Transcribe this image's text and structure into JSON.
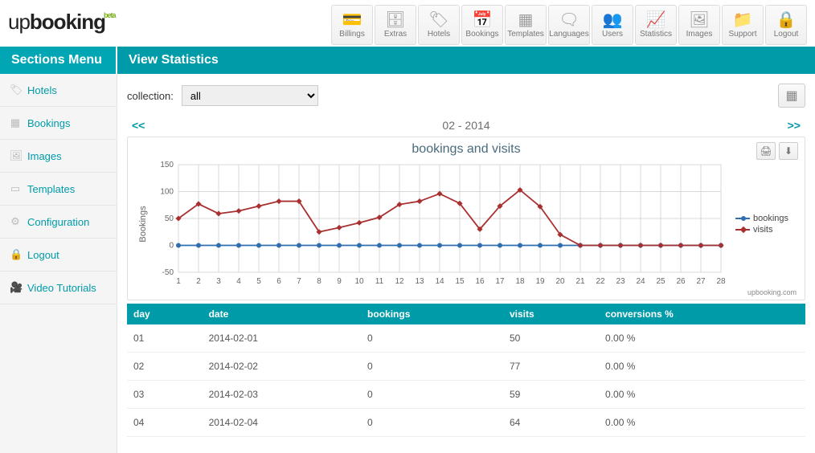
{
  "logo": {
    "prefix": "up",
    "main": "booking",
    "badge": "beta"
  },
  "topnav": [
    {
      "label": "Billings",
      "icon": "💳",
      "name": "billings"
    },
    {
      "label": "Extras",
      "icon": "🗄",
      "name": "extras"
    },
    {
      "label": "Hotels",
      "icon": "🏷",
      "name": "hotels"
    },
    {
      "label": "Bookings",
      "icon": "📅",
      "name": "bookings"
    },
    {
      "label": "Templates",
      "icon": "▦",
      "name": "templates"
    },
    {
      "label": "Languages",
      "icon": "🗨",
      "name": "languages"
    },
    {
      "label": "Users",
      "icon": "👥",
      "name": "users"
    },
    {
      "label": "Statistics",
      "icon": "📈",
      "name": "statistics"
    },
    {
      "label": "Images",
      "icon": "🖼",
      "name": "images"
    },
    {
      "label": "Support",
      "icon": "📁",
      "name": "support"
    },
    {
      "label": "Logout",
      "icon": "🔒",
      "name": "logout"
    }
  ],
  "tealbar": {
    "left": "Sections Menu",
    "right": "View Statistics"
  },
  "sidebar": [
    {
      "label": "Hotels",
      "icon": "🏷",
      "name": "hotels"
    },
    {
      "label": "Bookings",
      "icon": "▦",
      "name": "bookings"
    },
    {
      "label": "Images",
      "icon": "🖼",
      "name": "images"
    },
    {
      "label": "Templates",
      "icon": "▭",
      "name": "templates"
    },
    {
      "label": "Configuration",
      "icon": "⚙",
      "name": "configuration"
    },
    {
      "label": "Logout",
      "icon": "🔒",
      "name": "logout"
    },
    {
      "label": "Video Tutorials",
      "icon": "🎥",
      "name": "video-tutorials"
    }
  ],
  "toolbar": {
    "collection_label": "collection:",
    "collection_value": "all"
  },
  "monthnav": {
    "prev": "<<",
    "label": "02 - 2014",
    "next": ">>"
  },
  "chart": {
    "title": "bookings and visits",
    "ylabel": "Bookings",
    "credit": "upbooking.com",
    "legend": {
      "bookings": "bookings",
      "visits": "visits"
    }
  },
  "chart_data": {
    "type": "line",
    "title": "bookings and visits",
    "xlabel": "",
    "ylabel": "Bookings",
    "ylim": [
      -50,
      150
    ],
    "x": [
      1,
      2,
      3,
      4,
      5,
      6,
      7,
      8,
      9,
      10,
      11,
      12,
      13,
      14,
      15,
      16,
      17,
      18,
      19,
      20,
      21,
      22,
      23,
      24,
      25,
      26,
      27,
      28
    ],
    "series": [
      {
        "name": "bookings",
        "color": "#2f6fae",
        "values": [
          0,
          0,
          0,
          0,
          0,
          0,
          0,
          0,
          0,
          0,
          0,
          0,
          0,
          0,
          0,
          0,
          0,
          0,
          0,
          0,
          0,
          0,
          0,
          0,
          0,
          0,
          0,
          0
        ]
      },
      {
        "name": "visits",
        "color": "#a93030",
        "values": [
          50,
          77,
          59,
          64,
          73,
          82,
          82,
          25,
          33,
          42,
          52,
          76,
          82,
          96,
          78,
          30,
          73,
          103,
          72,
          20,
          0,
          0,
          0,
          0,
          0,
          0,
          0,
          0
        ]
      }
    ]
  },
  "table": {
    "headers": [
      "day",
      "date",
      "bookings",
      "visits",
      "conversions %"
    ],
    "rows": [
      [
        "01",
        "2014-02-01",
        "0",
        "50",
        "0.00 %"
      ],
      [
        "02",
        "2014-02-02",
        "0",
        "77",
        "0.00 %"
      ],
      [
        "03",
        "2014-02-03",
        "0",
        "59",
        "0.00 %"
      ],
      [
        "04",
        "2014-02-04",
        "0",
        "64",
        "0.00 %"
      ]
    ]
  }
}
